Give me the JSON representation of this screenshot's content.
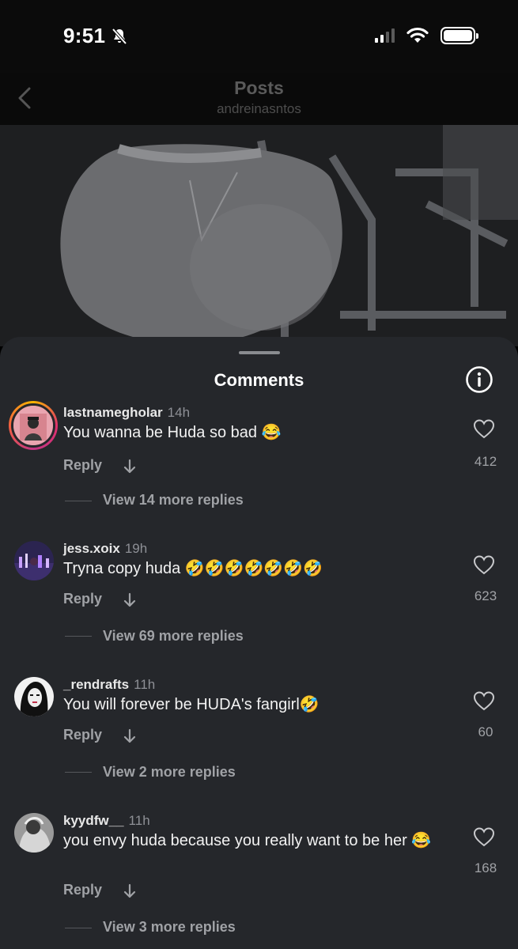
{
  "status_bar": {
    "time": "9:51",
    "silent": true,
    "signal_bars": 2,
    "battery": "full"
  },
  "header": {
    "title": "Posts",
    "subtitle": "andreinasntos"
  },
  "sheet": {
    "title": "Comments"
  },
  "comments": [
    {
      "username": "lastnamegholar",
      "time": "14h",
      "text": "You wanna be Huda so bad 😂",
      "likes": "412",
      "reply_label": "Reply",
      "view_more": "View 14 more replies",
      "story_ring": true
    },
    {
      "username": "jess.xoix",
      "time": "19h",
      "text": "Tryna copy huda 🤣🤣🤣🤣🤣🤣🤣",
      "likes": "623",
      "reply_label": "Reply",
      "view_more": "View 69 more replies",
      "story_ring": false
    },
    {
      "username": "_rendrafts",
      "time": "11h",
      "text": "You will forever be HUDA's fangirl🤣",
      "likes": "60",
      "reply_label": "Reply",
      "view_more": "View 2 more replies",
      "story_ring": false
    },
    {
      "username": "kyydfw__",
      "time": "11h",
      "text": "you envy huda because you really want to be her 😂",
      "likes": "168",
      "reply_label": "Reply",
      "view_more": "View 3 more replies",
      "story_ring": false
    }
  ],
  "icons": {
    "back": "chevron-left-icon",
    "info": "info-icon",
    "like": "heart-icon",
    "expand": "arrow-down-icon",
    "silent": "bell-slash-icon"
  }
}
